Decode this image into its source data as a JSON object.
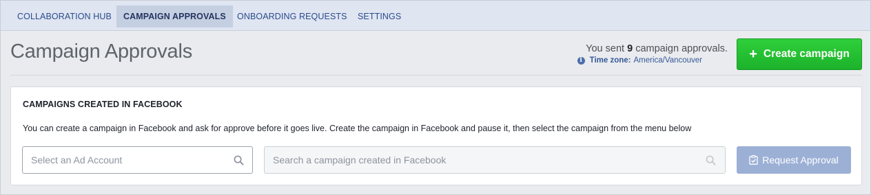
{
  "nav": {
    "items": [
      {
        "label": "COLLABORATION HUB",
        "active": false
      },
      {
        "label": "CAMPAIGN APPROVALS",
        "active": true
      },
      {
        "label": "ONBOARDING REQUESTS",
        "active": false
      },
      {
        "label": "SETTINGS",
        "active": false
      }
    ]
  },
  "header": {
    "title": "Campaign Approvals",
    "sent_prefix": "You sent",
    "sent_count": "9",
    "sent_suffix": "campaign approvals.",
    "timezone_label": "Time zone:",
    "timezone_value": "America/Vancouver",
    "create_button": "Create campaign"
  },
  "card": {
    "title": "CAMPAIGNS CREATED IN FACEBOOK",
    "description": "You can create a campaign in Facebook and ask for approve before it goes live. Create the campaign in Facebook and pause it, then select the campaign from the menu below",
    "ad_account_placeholder": "Select an Ad Account",
    "campaign_search_placeholder": "Search a campaign created in Facebook",
    "request_button": "Request Approval"
  },
  "colors": {
    "accent_green": "#1fb52d",
    "nav_text": "#2a4b8d",
    "disabled_button": "#9cb0d6"
  },
  "icons": [
    "info-icon",
    "plus-icon",
    "search-icon",
    "clipboard-check-icon"
  ]
}
